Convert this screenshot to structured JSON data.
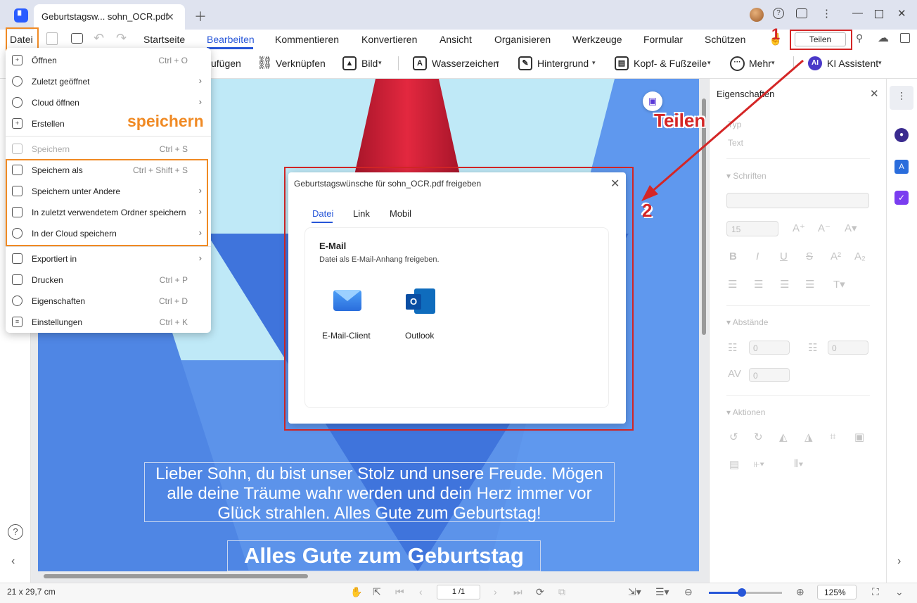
{
  "window": {
    "tab_title": "Geburtstagsw... sohn_OCR.pdf",
    "icons": [
      "app-logo",
      "close-icon",
      "plus-icon",
      "help-icon",
      "chat-icon",
      "more-icon",
      "minimize-icon",
      "maximize-icon",
      "window-close-icon"
    ]
  },
  "menubar": {
    "file_label": "Datei",
    "items": [
      "Startseite",
      "Bearbeiten",
      "Kommentieren",
      "Konvertieren",
      "Ansicht",
      "Organisieren",
      "Werkzeuge",
      "Formular",
      "Schützen"
    ],
    "active": "Bearbeiten",
    "share_label": "Teilen"
  },
  "toolbar": {
    "items": [
      "ufügen",
      "Verknüpfen",
      "Bild",
      "Wasserzeichen",
      "Hintergrund",
      "Kopf- & Fußzeile",
      "Mehr",
      "KI Assistent"
    ],
    "ai_badge": "AI"
  },
  "file_menu": {
    "items": [
      {
        "label": "Öffnen",
        "shortcut": "Ctrl + O",
        "submenu": false,
        "disabled": false
      },
      {
        "label": "Zuletzt geöffnet",
        "shortcut": "",
        "submenu": true,
        "disabled": false
      },
      {
        "label": "Cloud öffnen",
        "shortcut": "",
        "submenu": true,
        "disabled": false
      },
      {
        "label": "Erstellen",
        "shortcut": "",
        "submenu": false,
        "disabled": false
      },
      {
        "label": "Speichern",
        "shortcut": "Ctrl + S",
        "submenu": false,
        "disabled": true
      },
      {
        "label": "Speichern als",
        "shortcut": "Ctrl + Shift + S",
        "submenu": false,
        "disabled": false
      },
      {
        "label": "Speichern unter Andere",
        "shortcut": "",
        "submenu": true,
        "disabled": false
      },
      {
        "label": "In zuletzt verwendetem Ordner speichern",
        "shortcut": "",
        "submenu": true,
        "disabled": false
      },
      {
        "label": "In der Cloud speichern",
        "shortcut": "",
        "submenu": true,
        "disabled": false
      },
      {
        "label": "Exportiert in",
        "shortcut": "",
        "submenu": true,
        "disabled": false
      },
      {
        "label": "Drucken",
        "shortcut": "Ctrl + P",
        "submenu": false,
        "disabled": false
      },
      {
        "label": "Eigenschaften",
        "shortcut": "Ctrl + D",
        "submenu": false,
        "disabled": false
      },
      {
        "label": "Einstellungen",
        "shortcut": "Ctrl + K",
        "submenu": false,
        "disabled": false
      }
    ]
  },
  "annotations": {
    "save_label": "speichern",
    "share_label": "Teilen",
    "step1": "1",
    "step2": "2",
    "color": "#d42626",
    "save_color": "#f08a24"
  },
  "document": {
    "greeting": "Lieber Sohn, du bist unser Stolz und unsere Freude. Mögen alle deine Träume wahr werden und dein Herz immer vor Glück strahlen. Alles Gute zum Geburtstag!",
    "headline": "Alles Gute zum Geburtstag"
  },
  "share_dialog": {
    "title": "Geburtstagswünsche für sohn_OCR.pdf freigeben",
    "tabs": [
      "Datei",
      "Link",
      "Mobil"
    ],
    "active_tab": "Datei",
    "section_title": "E-Mail",
    "section_desc": "Datei als E-Mail-Anhang freigeben.",
    "options": [
      "E-Mail-Client",
      "Outlook"
    ]
  },
  "properties": {
    "title": "Eigenschaften",
    "type_label": "Typ",
    "type_value": "Text",
    "fonts_label": "Schriften",
    "font_size": "15",
    "spacing_label": "Abstände",
    "line_spacing": "0",
    "paragraph_spacing": "0",
    "char_spacing": "0",
    "actions_label": "Aktionen"
  },
  "status": {
    "page_size": "21 x 29,7 cm",
    "page": "1 /1",
    "zoom": "125%"
  },
  "colors": {
    "accent": "#2756d8",
    "page_bg": "#bfe9f7"
  }
}
